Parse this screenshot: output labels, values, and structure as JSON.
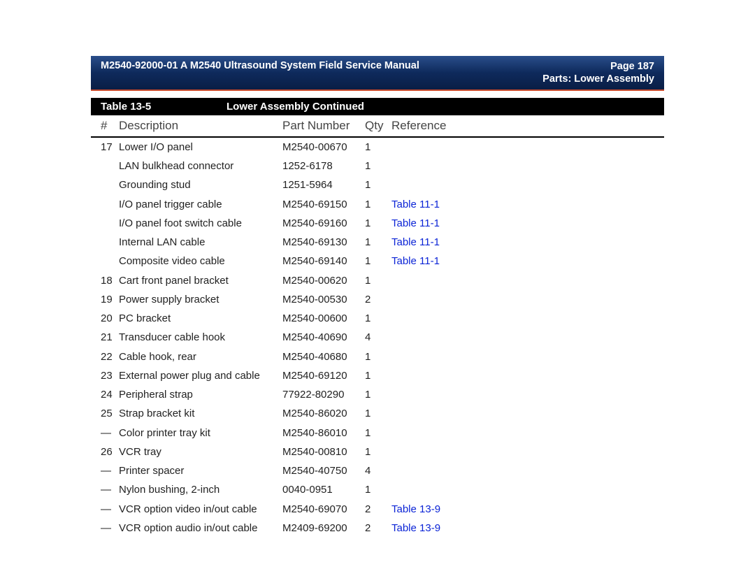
{
  "header": {
    "left": "M2540-92000-01 A M2540 Ultrasound System Field Service Manual",
    "page_label": "Page",
    "page_number": "187",
    "section": "Parts: Lower Assembly"
  },
  "table": {
    "number_label": "Table 13-5",
    "title": "Lower Assembly  Continued",
    "columns": {
      "num": "#",
      "desc": "Description",
      "part": "Part Number",
      "qty": "Qty",
      "ref": "Reference"
    },
    "rows": [
      {
        "num": "17",
        "desc": "Lower I/O panel",
        "part": "M2540-00670",
        "qty": "1",
        "ref": ""
      },
      {
        "num": "",
        "desc": "LAN bulkhead connector",
        "part": "1252-6178",
        "qty": "1",
        "ref": ""
      },
      {
        "num": "",
        "desc": "Grounding stud",
        "part": "1251-5964",
        "qty": "1",
        "ref": ""
      },
      {
        "num": "",
        "desc": "I/O panel trigger cable",
        "part": "M2540-69150",
        "qty": "1",
        "ref": "Table 11-1"
      },
      {
        "num": "",
        "desc": "I/O panel foot switch cable",
        "part": "M2540-69160",
        "qty": "1",
        "ref": "Table 11-1"
      },
      {
        "num": "",
        "desc": "Internal LAN cable",
        "part": "M2540-69130",
        "qty": "1",
        "ref": "Table 11-1"
      },
      {
        "num": "",
        "desc": "Composite video cable",
        "part": "M2540-69140",
        "qty": "1",
        "ref": "Table 11-1"
      },
      {
        "num": "18",
        "desc": "Cart front panel bracket",
        "part": "M2540-00620",
        "qty": "1",
        "ref": ""
      },
      {
        "num": "19",
        "desc": "Power supply bracket",
        "part": "M2540-00530",
        "qty": "2",
        "ref": ""
      },
      {
        "num": "20",
        "desc": "PC bracket",
        "part": "M2540-00600",
        "qty": "1",
        "ref": ""
      },
      {
        "num": "21",
        "desc": "Transducer cable hook",
        "part": "M2540-40690",
        "qty": "4",
        "ref": ""
      },
      {
        "num": "22",
        "desc": "Cable hook, rear",
        "part": "M2540-40680",
        "qty": "1",
        "ref": ""
      },
      {
        "num": "23",
        "desc": "External power plug and cable",
        "part": "M2540-69120",
        "qty": "1",
        "ref": ""
      },
      {
        "num": "24",
        "desc": "Peripheral strap",
        "part": "77922-80290",
        "qty": "1",
        "ref": ""
      },
      {
        "num": "25",
        "desc": "Strap bracket kit",
        "part": "M2540-86020",
        "qty": "1",
        "ref": ""
      },
      {
        "num": "—",
        "desc": "Color printer tray kit",
        "part": "M2540-86010",
        "qty": "1",
        "ref": ""
      },
      {
        "num": "26",
        "desc": "VCR tray",
        "part": "M2540-00810",
        "qty": "1",
        "ref": ""
      },
      {
        "num": "—",
        "desc": "Printer spacer",
        "part": "M2540-40750",
        "qty": "4",
        "ref": ""
      },
      {
        "num": "—",
        "desc": "Nylon bushing, 2-inch",
        "part": "0040-0951",
        "qty": "1",
        "ref": ""
      },
      {
        "num": "—",
        "desc": "VCR option video in/out cable",
        "part": "M2540-69070",
        "qty": "2",
        "ref": "Table 13-9"
      },
      {
        "num": "—",
        "desc": "VCR option audio in/out cable",
        "part": "M2409-69200",
        "qty": "2",
        "ref": "Table 13-9"
      }
    ]
  }
}
